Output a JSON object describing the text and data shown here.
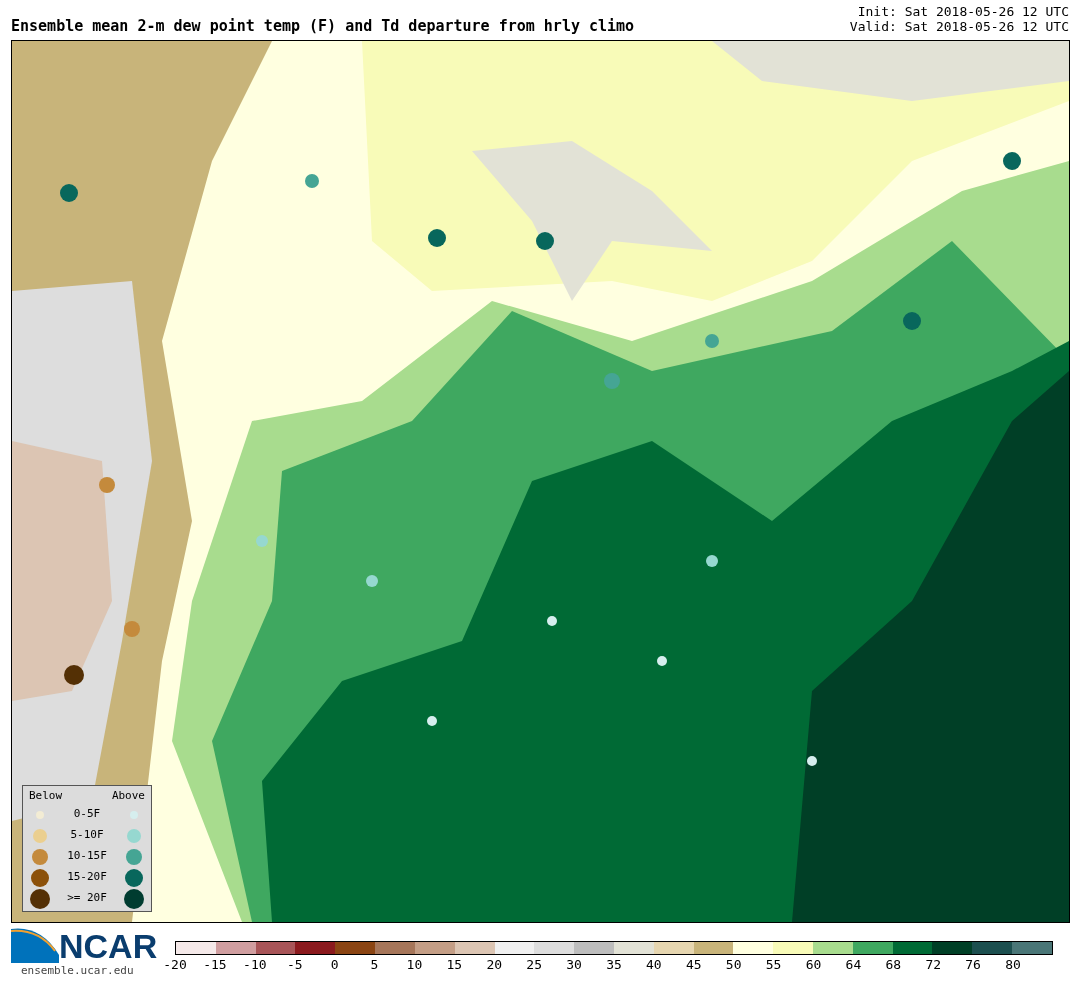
{
  "title": "Ensemble mean 2-m dew point temp (F) and Td departure from hrly climo",
  "init": "Init: Sat 2018-05-26 12 UTC",
  "valid": "Valid: Sat 2018-05-26 12 UTC",
  "legend": {
    "below_label": "Below",
    "above_label": "Above",
    "rows": [
      {
        "label": "0-5F",
        "below": {
          "color": "#f3ecd4"
        },
        "above": {
          "color": "#d6eeee"
        }
      },
      {
        "label": "5-10F",
        "below": {
          "color": "#ebcf8f"
        },
        "above": {
          "color": "#96d8d0"
        }
      },
      {
        "label": "10-15F",
        "below": {
          "color": "#c48a3c"
        },
        "above": {
          "color": "#45a594"
        }
      },
      {
        "label": "15-20F",
        "below": {
          "color": "#8c510a"
        },
        "above": {
          "color": "#08675c"
        }
      },
      {
        "label": ">= 20F",
        "below": {
          "color": "#543005"
        },
        "above": {
          "color": "#003c30"
        }
      }
    ]
  },
  "logo": {
    "text": "NCAR",
    "url": "ensemble.ucar.edu"
  },
  "colorbar": [
    {
      "label": "-20",
      "color": "#f5e9e9"
    },
    {
      "label": "-15",
      "color": "#d09ea0"
    },
    {
      "label": "-10",
      "color": "#a85558"
    },
    {
      "label": "-5",
      "color": "#8b1a1e"
    },
    {
      "label": "0",
      "color": "#8b4513"
    },
    {
      "label": "5",
      "color": "#a6765a"
    },
    {
      "label": "10",
      "color": "#c49e86"
    },
    {
      "label": "15",
      "color": "#dcc5b3"
    },
    {
      "label": "20",
      "color": "#f0f0f0"
    },
    {
      "label": "25",
      "color": "#dddddd"
    },
    {
      "label": "30",
      "color": "#bdbdbd"
    },
    {
      "label": "35",
      "color": "#e2e2d6"
    },
    {
      "label": "40",
      "color": "#e6d6b0"
    },
    {
      "label": "45",
      "color": "#c8b47a"
    },
    {
      "label": "50",
      "color": "#ffffe0"
    },
    {
      "label": "55",
      "color": "#f8fbb8"
    },
    {
      "label": "60",
      "color": "#a8dc8e"
    },
    {
      "label": "64",
      "color": "#3fa860"
    },
    {
      "label": "68",
      "color": "#006a35"
    },
    {
      "label": "72",
      "color": "#003f26"
    },
    {
      "label": "76",
      "color": "#1c4f4f"
    },
    {
      "label": "80",
      "color": "#4a7677"
    }
  ]
}
